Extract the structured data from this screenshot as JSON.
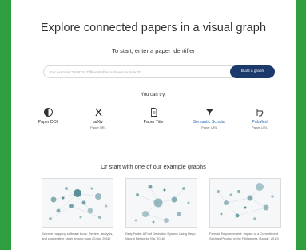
{
  "main": {
    "title": "Explore connected papers in a visual graph",
    "subtitle": "To start, enter a paper identifier",
    "search": {
      "placeholder": "For example \"DARTS: Differentiable Architecture Search\"",
      "button_label": "Build a graph"
    },
    "can_try_label": "You can try:",
    "options": [
      {
        "label": "Paper DOI",
        "sub": "",
        "icon": "doi-icon"
      },
      {
        "label": "arXiv",
        "sub": "Paper URL",
        "icon": "arxiv-icon"
      },
      {
        "label": "Paper Title",
        "sub": "",
        "icon": "document-icon"
      },
      {
        "label": "Semantic Scholar",
        "sub": "Paper URL",
        "icon": "semantic-scholar-icon"
      },
      {
        "label": "PubMed",
        "sub": "Paper URL",
        "icon": "pubmed-icon"
      }
    ],
    "examples_heading": "Or start with one of our example graphs",
    "examples": [
      {
        "caption": "Science mapping software tools: Review, analysis, and cooperative study among tools (Cobo, 2011)"
      },
      {
        "caption": "DeepFruits: A Fruit Detection System Using Deep Neural Networks (Sa, 2016)"
      },
      {
        "caption": "Female Empowerment: Impact of a Commitment Savings Product in the Philippines (Ashraf, 2010)"
      }
    ]
  },
  "colors": {
    "background": "#2e9e3e",
    "button": "#1b3a6b",
    "link": "#2a6ab7",
    "graph_node": "#5a8f9a"
  }
}
